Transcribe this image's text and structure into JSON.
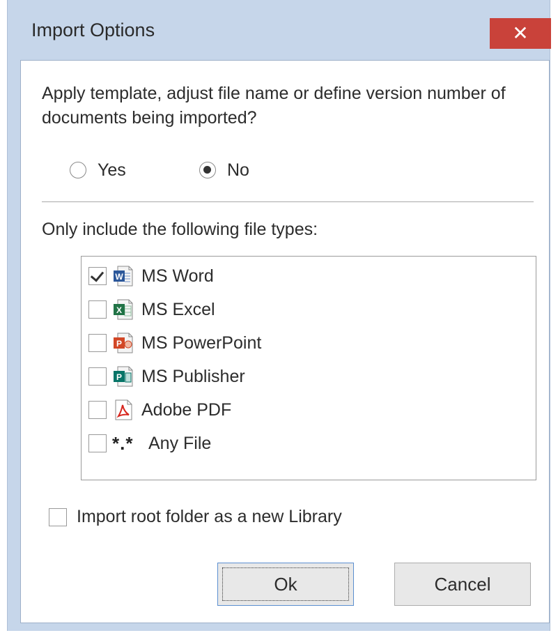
{
  "window": {
    "title": "Import Options",
    "close_glyph": "✕"
  },
  "question": {
    "text": "Apply template, adjust file name or define version number of documents being imported?",
    "options": [
      {
        "label": "Yes",
        "selected": false
      },
      {
        "label": "No",
        "selected": true
      }
    ]
  },
  "filetypes": {
    "label": "Only include the following file types:",
    "items": [
      {
        "label": "MS Word",
        "checked": true,
        "icon": "word-icon"
      },
      {
        "label": "MS Excel",
        "checked": false,
        "icon": "excel-icon"
      },
      {
        "label": "MS PowerPoint",
        "checked": false,
        "icon": "powerpoint-icon"
      },
      {
        "label": "MS Publisher",
        "checked": false,
        "icon": "publisher-icon"
      },
      {
        "label": "Adobe PDF",
        "checked": false,
        "icon": "pdf-icon"
      },
      {
        "label": "Any File",
        "checked": false,
        "icon": "any-file-glyph",
        "glyph": "*.*"
      }
    ]
  },
  "root_folder": {
    "label": "Import root folder as a new Library",
    "checked": false
  },
  "buttons": {
    "ok": "Ok",
    "cancel": "Cancel"
  },
  "colors": {
    "close": "#c9423a",
    "frame": "#c6d6ea",
    "word": "#2b579a",
    "excel": "#217346",
    "powerpoint": "#d24726",
    "publisher": "#077568",
    "pdf": "#d7261e"
  }
}
